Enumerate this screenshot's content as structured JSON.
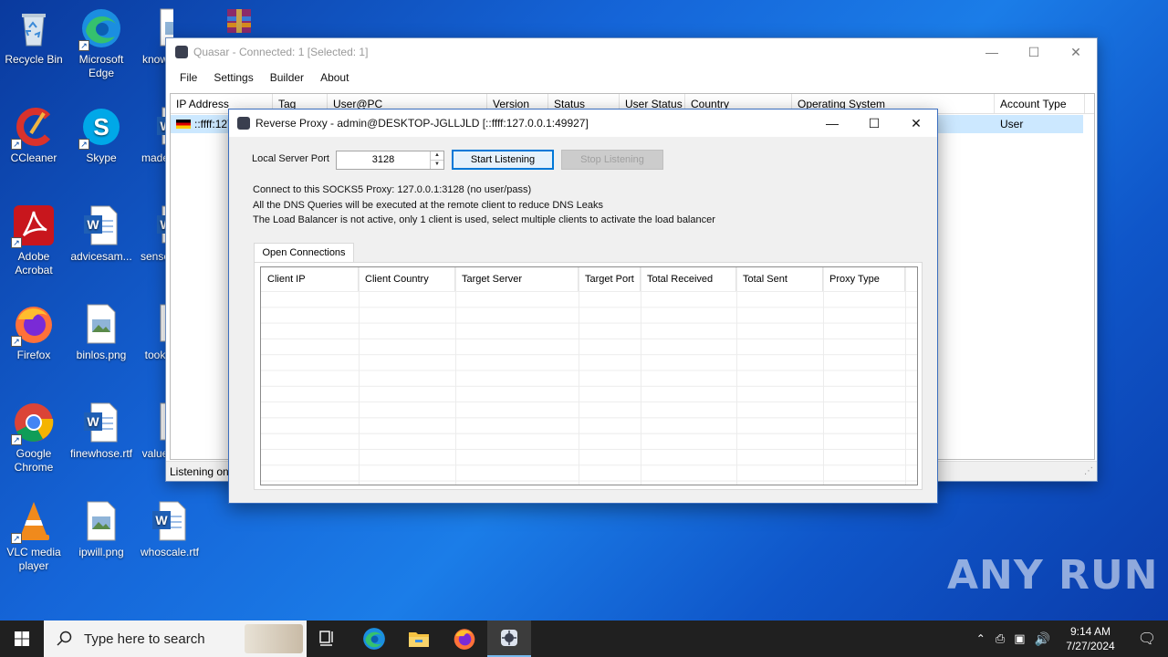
{
  "desktop": {
    "icons": [
      {
        "label": "Recycle Bin"
      },
      {
        "label": "Microsoft Edge"
      },
      {
        "label": "know"
      },
      {
        "label": ""
      },
      {
        "label": "CCleaner"
      },
      {
        "label": "Skype"
      },
      {
        "label": "made"
      },
      {
        "label": "Adobe Acrobat"
      },
      {
        "label": "advicesam..."
      },
      {
        "label": "sense"
      },
      {
        "label": "Firefox"
      },
      {
        "label": "binlos.png"
      },
      {
        "label": "took"
      },
      {
        "label": "Google Chrome"
      },
      {
        "label": "finewhose.rtf"
      },
      {
        "label": "value"
      },
      {
        "label": "VLC media player"
      },
      {
        "label": "ipwill.png"
      },
      {
        "label": "whoscale.rtf"
      }
    ]
  },
  "quasar": {
    "title": "Quasar - Connected: 1 [Selected: 1]",
    "menu": [
      "File",
      "Settings",
      "Builder",
      "About"
    ],
    "columns": [
      "IP Address",
      "Tag",
      "User@PC",
      "Version",
      "Status",
      "User Status",
      "Country",
      "Operating System",
      "Account Type"
    ],
    "row": {
      "ip": "::ffff:127",
      "account_type": "User"
    },
    "status": "Listening on"
  },
  "proxy": {
    "title": "Reverse Proxy - admin@DESKTOP-JGLLJLD [::ffff:127.0.0.1:49927]",
    "port_label": "Local Server Port",
    "port_value": "3128",
    "start_button": "Start Listening",
    "stop_button": "Stop Listening",
    "info": [
      "Connect to this SOCKS5 Proxy: 127.0.0.1:3128 (no user/pass)",
      "All the DNS Queries will be executed at the remote client to reduce DNS Leaks",
      "The Load Balancer is not active, only 1 client is used, select multiple clients to activate the load balancer"
    ],
    "tab": "Open Connections",
    "columns": [
      "Client IP",
      "Client Country",
      "Target Server",
      "Target Port",
      "Total Received",
      "Total Sent",
      "Proxy Type"
    ]
  },
  "taskbar": {
    "search_placeholder": "Type here to search",
    "time": "9:14 AM",
    "date": "7/27/2024"
  },
  "watermark": "ANY RUN"
}
